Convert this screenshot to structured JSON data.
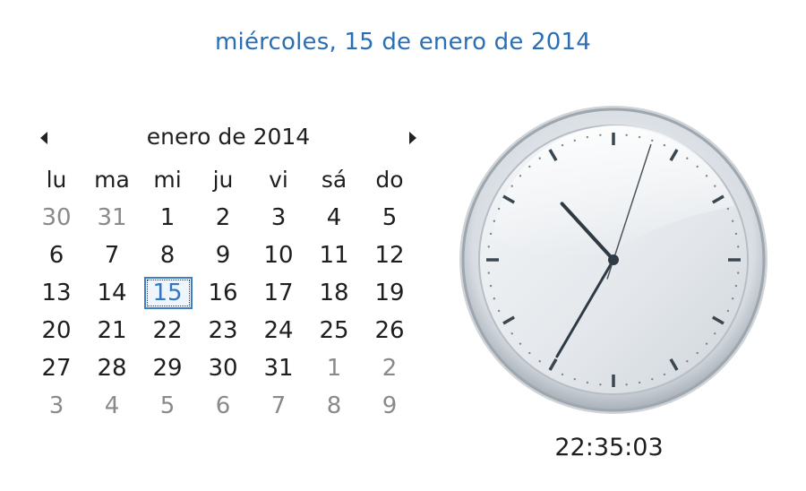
{
  "header": {
    "full_date": "miércoles, 15 de enero de 2014"
  },
  "calendar": {
    "month_title": "enero de 2014",
    "prev_icon": "chevron-left-icon",
    "next_icon": "chevron-right-icon",
    "weekdays": [
      "lu",
      "ma",
      "mi",
      "ju",
      "vi",
      "sá",
      "do"
    ],
    "weeks": [
      [
        {
          "d": "30",
          "dim": true
        },
        {
          "d": "31",
          "dim": true
        },
        {
          "d": "1"
        },
        {
          "d": "2"
        },
        {
          "d": "3"
        },
        {
          "d": "4"
        },
        {
          "d": "5"
        }
      ],
      [
        {
          "d": "6"
        },
        {
          "d": "7"
        },
        {
          "d": "8"
        },
        {
          "d": "9"
        },
        {
          "d": "10"
        },
        {
          "d": "11"
        },
        {
          "d": "12"
        }
      ],
      [
        {
          "d": "13"
        },
        {
          "d": "14"
        },
        {
          "d": "15",
          "today": true
        },
        {
          "d": "16"
        },
        {
          "d": "17"
        },
        {
          "d": "18"
        },
        {
          "d": "19"
        }
      ],
      [
        {
          "d": "20"
        },
        {
          "d": "21"
        },
        {
          "d": "22"
        },
        {
          "d": "23"
        },
        {
          "d": "24"
        },
        {
          "d": "25"
        },
        {
          "d": "26"
        }
      ],
      [
        {
          "d": "27"
        },
        {
          "d": "28"
        },
        {
          "d": "29"
        },
        {
          "d": "30"
        },
        {
          "d": "31"
        },
        {
          "d": "1",
          "dim": true
        },
        {
          "d": "2",
          "dim": true
        }
      ],
      [
        {
          "d": "3",
          "dim": true
        },
        {
          "d": "4",
          "dim": true
        },
        {
          "d": "5",
          "dim": true
        },
        {
          "d": "6",
          "dim": true
        },
        {
          "d": "7",
          "dim": true
        },
        {
          "d": "8",
          "dim": true
        },
        {
          "d": "9",
          "dim": true
        }
      ]
    ],
    "colors": {
      "today_accent": "#2a6fb5",
      "dim_day": "#8a8a8a"
    }
  },
  "clock": {
    "hour": 22,
    "minute": 35,
    "second": 3,
    "time_text": "22:35:03",
    "face_icon": "analog-clock-icon"
  }
}
